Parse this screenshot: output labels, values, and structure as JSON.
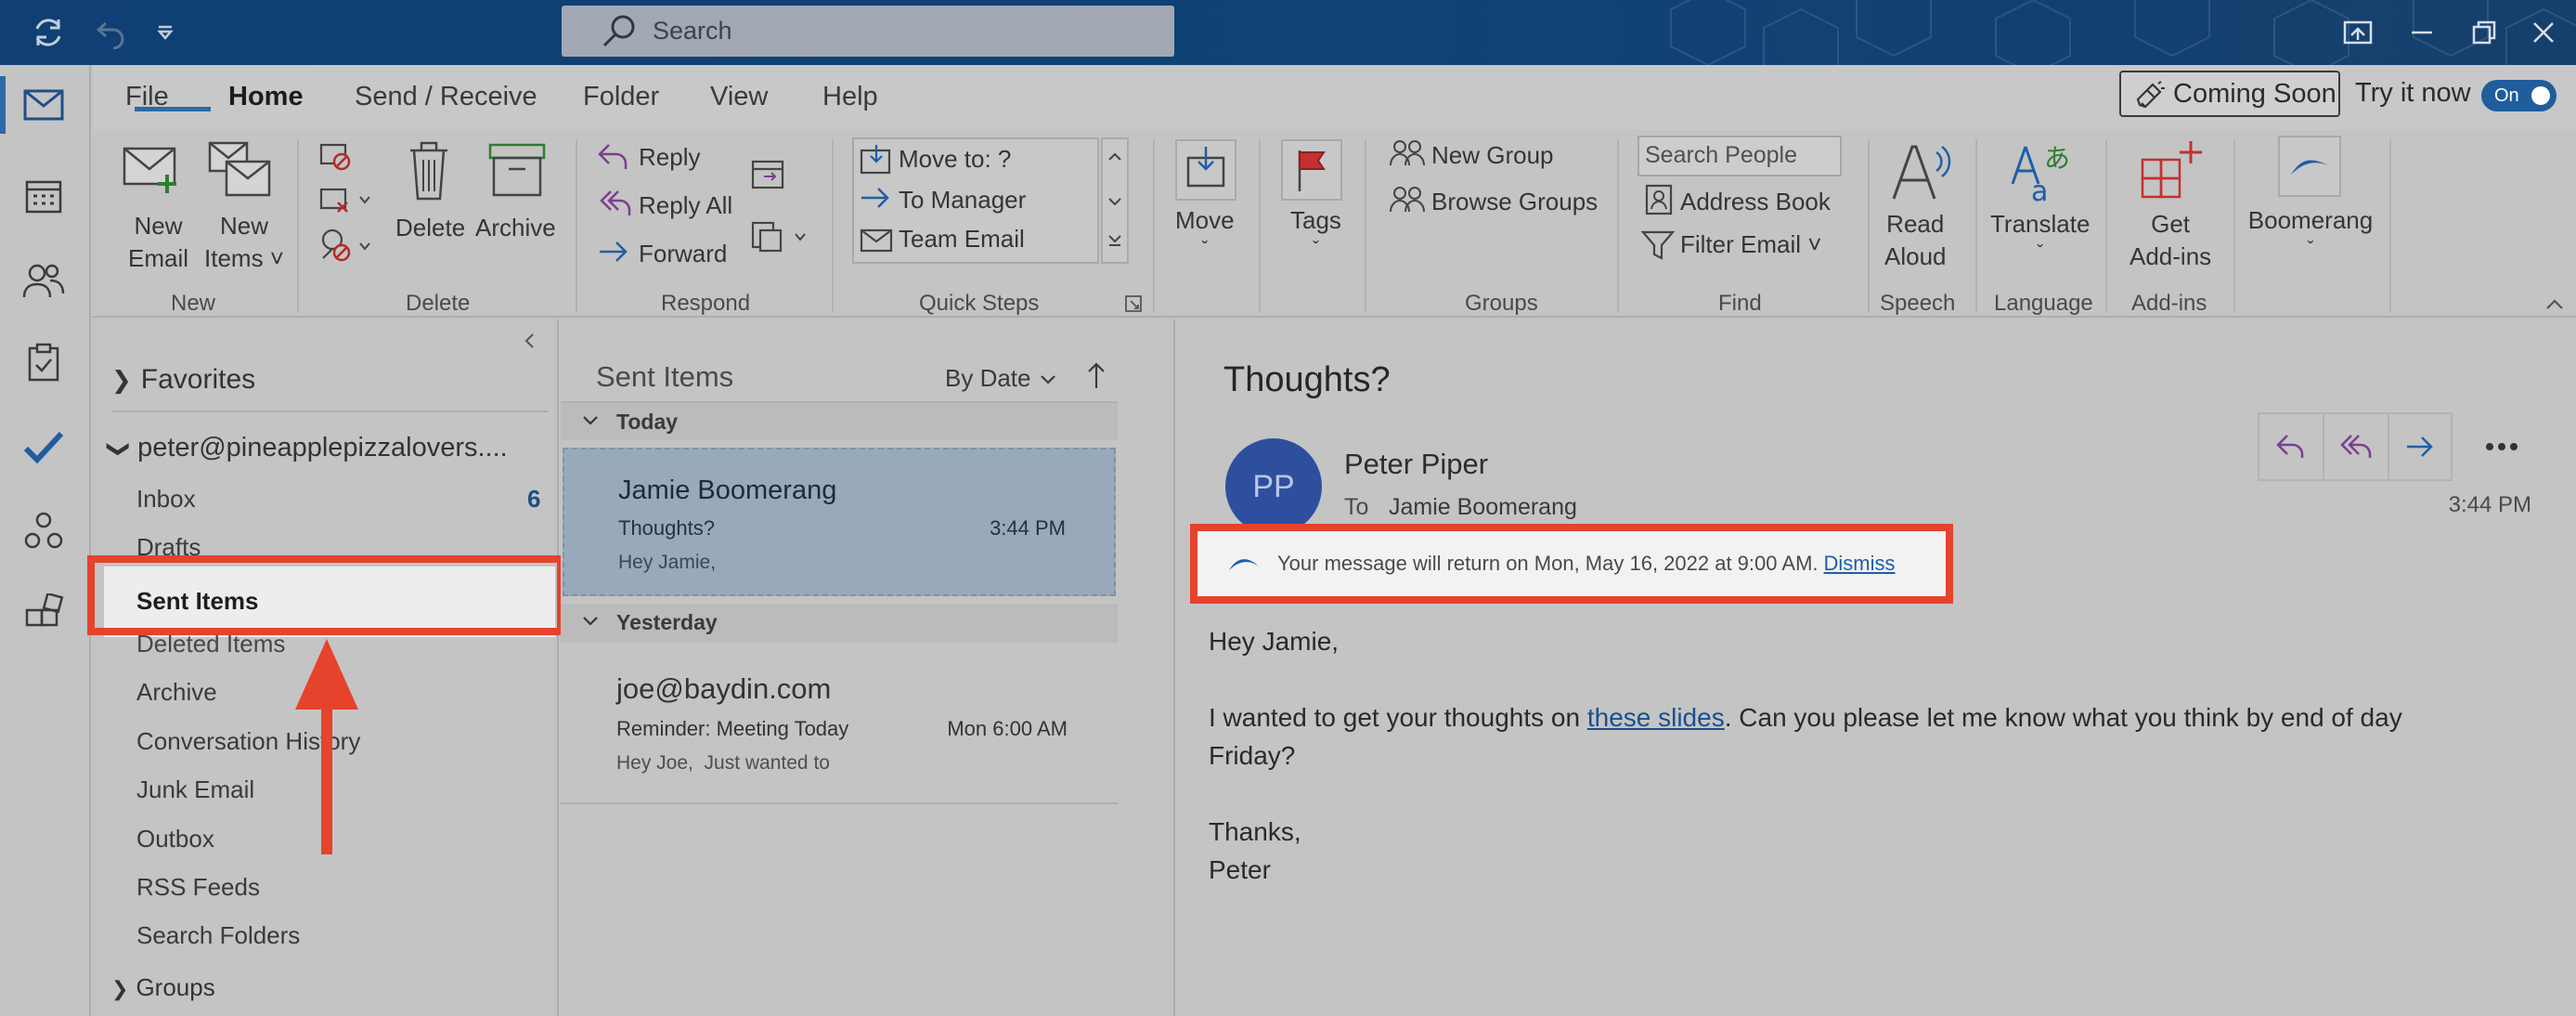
{
  "titlebar": {
    "search_placeholder": "Search"
  },
  "menu": {
    "tabs": [
      "File",
      "Home",
      "Send / Receive",
      "Folder",
      "View",
      "Help"
    ],
    "coming_soon": "Coming Soon",
    "try_it_now": "Try it now",
    "toggle": "On"
  },
  "ribbon": {
    "new_email": [
      "New",
      "Email"
    ],
    "new_items": [
      "New",
      "Items ˅"
    ],
    "delete": "Delete",
    "archive": "Archive",
    "reply": "Reply",
    "reply_all": "Reply All",
    "forward": "Forward",
    "quick_steps": [
      "Move to: ?",
      "To Manager",
      "Team Email"
    ],
    "move": "Move",
    "tags": "Tags",
    "new_group": "New Group",
    "browse_groups": "Browse Groups",
    "search_people": "Search People",
    "address_book": "Address Book",
    "filter_email": "Filter Email ˅",
    "read_aloud": [
      "Read",
      "Aloud"
    ],
    "translate": "Translate",
    "get_addins": [
      "Get",
      "Add-ins"
    ],
    "boomerang": "Boomerang",
    "groups": [
      "New",
      "Delete",
      "Respond",
      "Quick Steps",
      "Groups",
      "Find",
      "Speech",
      "Language",
      "Add-ins"
    ]
  },
  "folders": {
    "favorites": "Favorites",
    "account": "peter@pineapplepizzalovers....",
    "inbox": "Inbox",
    "inbox_count": "6",
    "items": [
      "Drafts",
      "Sent Items",
      "Deleted Items",
      "Archive",
      "Conversation History",
      "Junk Email",
      "Outbox",
      "RSS Feeds",
      "Search Folders"
    ],
    "groups": "Groups"
  },
  "message_list": {
    "title": "Sent Items",
    "sort": "By Date",
    "today": "Today",
    "yesterday": "Yesterday",
    "messages": [
      {
        "sender": "Jamie Boomerang",
        "subject": "Thoughts?",
        "time": "3:44 PM",
        "preview": "Hey Jamie,"
      },
      {
        "sender": "joe@baydin.com",
        "subject": "Reminder: Meeting Today",
        "time": "Mon 6:00 AM",
        "preview": "Hey Joe,  Just wanted to"
      }
    ]
  },
  "reading": {
    "subject": "Thoughts?",
    "avatar": "PP",
    "from": "Peter Piper",
    "to_label": "To",
    "to": "Jamie Boomerang",
    "time": "3:44 PM",
    "banner": "Your message will return on Mon, May 16, 2022 at 9:00 AM.",
    "dismiss": "Dismiss",
    "greeting": "Hey Jamie,",
    "body_pre": "I wanted to get your thoughts on ",
    "body_link": "these slides",
    "body_post": ". Can you please let me know what you think by end of day",
    "body_line2": "Friday?",
    "signoff": "Thanks,",
    "signature": "Peter"
  },
  "colors": {
    "annotation_red": "#e5432b",
    "accent_blue": "#2b6aa6",
    "avatar_blue": "#2d4f9e"
  }
}
